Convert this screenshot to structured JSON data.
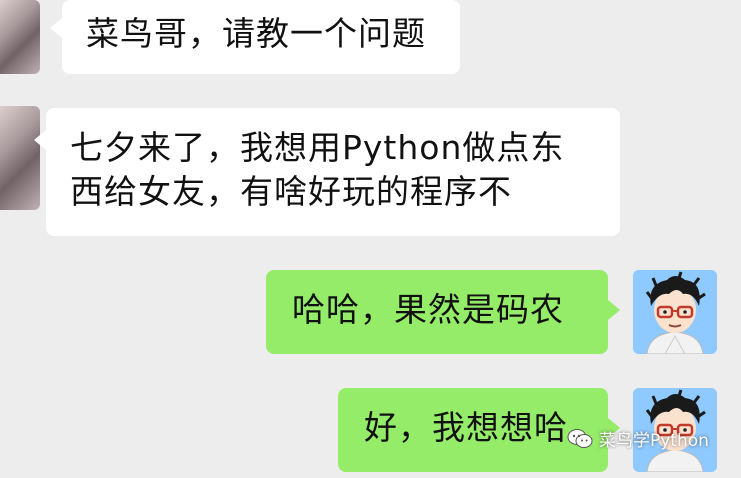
{
  "messages": [
    {
      "side": "in",
      "lines": [
        "菜鸟哥，请教一个问题"
      ]
    },
    {
      "side": "in",
      "lines": [
        "七夕来了，我想用Python做点东",
        "西给女友，有啥好玩的程序不"
      ]
    },
    {
      "side": "out",
      "lines": [
        "哈哈，果然是码农"
      ]
    },
    {
      "side": "out",
      "lines": [
        "好，我想想哈"
      ]
    }
  ],
  "watermark": {
    "text": "菜鸟学Python"
  },
  "colors": {
    "background": "#ededed",
    "incoming_bubble": "#ffffff",
    "outgoing_bubble": "#95ec69",
    "avatar_bg": "#8ec9ff"
  }
}
